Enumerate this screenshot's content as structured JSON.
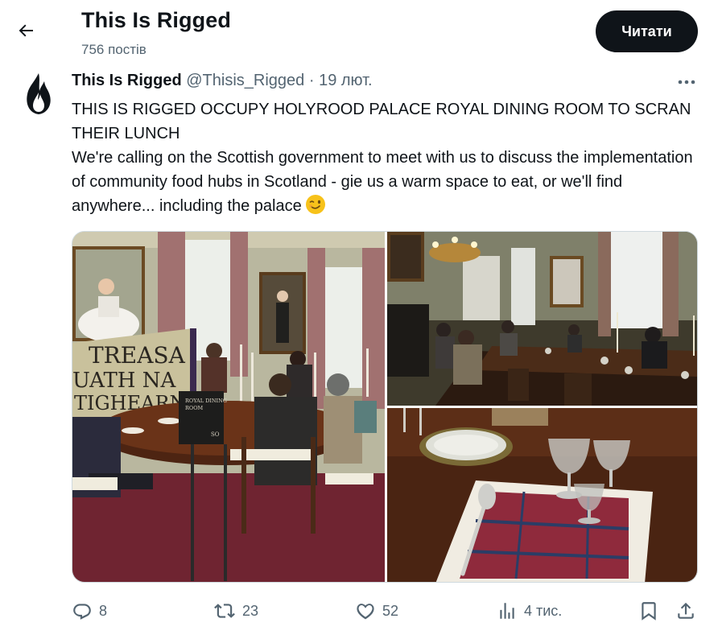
{
  "header": {
    "title": "This Is Rigged",
    "post_count": "756 постів",
    "follow_label": "Читати"
  },
  "tweet": {
    "name": "This Is Rigged",
    "handle": "@Thisis_Rigged",
    "separator": "·",
    "date": "19 лют.",
    "text_line1": "THIS IS RIGGED OCCUPY HOLYROOD PALACE ROYAL DINING ROOM TO SCRAN THEIR LUNCH",
    "text_line2": "We're calling on the Scottish government to meet with us to discuss the implementation of community food hubs in Scotland - gie us a warm space to eat, or we'll find anywhere... including the palace",
    "emoji": "winking-face"
  },
  "media": {
    "photo1": {
      "banner_text": [
        "TREASA",
        "UATH NA",
        "TIGHEARN"
      ],
      "sign_text": [
        "ROYAL DINING",
        "ROOM",
        "SO"
      ]
    }
  },
  "actions": {
    "replies": "8",
    "retweets": "23",
    "likes": "52",
    "views": "4 тис."
  },
  "icons": [
    "back-arrow-icon",
    "fire-logo-icon",
    "more-dots-icon",
    "reply-icon",
    "retweet-icon",
    "like-icon",
    "views-icon",
    "bookmark-icon",
    "share-icon"
  ],
  "colors": {
    "text": "#0f1419",
    "secondary": "#536471",
    "button": "#0f1419"
  }
}
